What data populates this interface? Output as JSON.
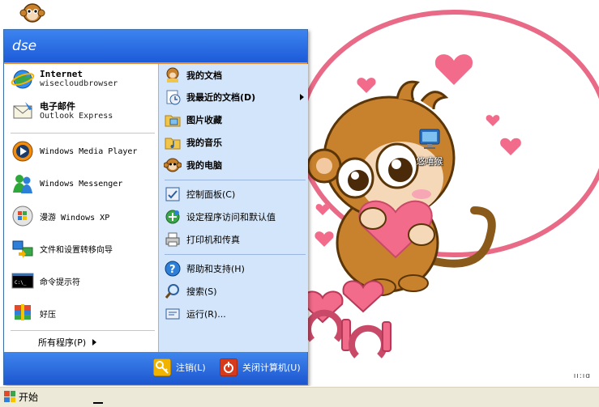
{
  "start_menu": {
    "user_name": "dse",
    "pinned": [
      {
        "title": "Internet",
        "subtitle": "wisecloudbrowser",
        "icon": "internet-browser-icon"
      },
      {
        "title": "电子邮件",
        "subtitle": "Outlook Express",
        "icon": "outlook-express-icon"
      }
    ],
    "recent": [
      {
        "label": "Windows Media Player",
        "icon": "media-player-icon"
      },
      {
        "label": "Windows Messenger",
        "icon": "messenger-icon"
      },
      {
        "label": "漫游 Windows XP",
        "icon": "xp-tour-icon"
      },
      {
        "label": "文件和设置转移向导",
        "icon": "transfer-wizard-icon"
      },
      {
        "label": "命令提示符",
        "icon": "command-prompt-icon"
      },
      {
        "label": "好压",
        "icon": "haozip-icon"
      }
    ],
    "all_programs": "所有程序(P)",
    "right": [
      {
        "label": "我的文档",
        "icon": "my-documents-icon"
      },
      {
        "label": "我最近的文档(D)",
        "icon": "recent-documents-icon",
        "submenu": true
      },
      {
        "label": "图片收藏",
        "icon": "my-pictures-icon"
      },
      {
        "label": "我的音乐",
        "icon": "my-music-icon"
      },
      {
        "label": "我的电脑",
        "icon": "my-computer-icon"
      },
      {
        "label": "控制面板(C)",
        "icon": "control-panel-icon"
      },
      {
        "label": "设定程序访问和默认值",
        "icon": "program-access-icon"
      },
      {
        "label": "打印机和传真",
        "icon": "printers-icon"
      },
      {
        "label": "帮助和支持(H)",
        "icon": "help-icon"
      },
      {
        "label": "搜索(S)",
        "icon": "search-icon"
      },
      {
        "label": "运行(R)...",
        "icon": "run-icon"
      }
    ],
    "logoff": "注销(L)",
    "shutdown": "关闭计算机(U)"
  },
  "taskbar": {
    "start_label": "开始",
    "tray_text": "ıı:ıɑ"
  },
  "desktop": {
    "icon_label": "悠嘻猴"
  },
  "colors": {
    "header_blue": "#1d5ad8",
    "right_pane": "#d3e5fa",
    "accent_orange": "#e88c2a"
  }
}
